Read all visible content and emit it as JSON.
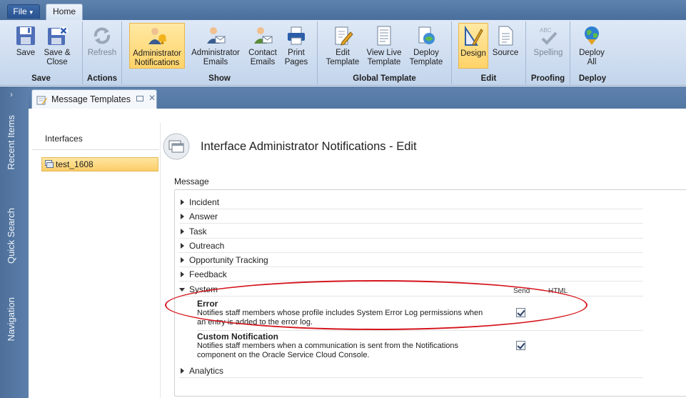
{
  "tabs": {
    "file": "File",
    "home": "Home"
  },
  "ribbon": {
    "groups": [
      {
        "label": "Save",
        "buttons": [
          {
            "label1": "Save",
            "label2": "",
            "icon": "floppy-icon"
          },
          {
            "label1": "Save &",
            "label2": "Close",
            "icon": "save-close-icon"
          }
        ]
      },
      {
        "label": "Actions",
        "buttons": [
          {
            "label1": "Refresh",
            "label2": "",
            "icon": "refresh-icon"
          }
        ]
      },
      {
        "label": "Show",
        "buttons": [
          {
            "label1": "Administrator",
            "label2": "Notifications",
            "icon": "admin-bell-icon"
          },
          {
            "label1": "Administrator",
            "label2": "Emails",
            "icon": "admin-email-icon"
          },
          {
            "label1": "Contact",
            "label2": "Emails",
            "icon": "contact-email-icon"
          },
          {
            "label1": "Print",
            "label2": "Pages",
            "icon": "printer-icon"
          }
        ]
      },
      {
        "label": "Global Template",
        "buttons": [
          {
            "label1": "Edit",
            "label2": "Template",
            "icon": "edit-template-icon"
          },
          {
            "label1": "View Live",
            "label2": "Template",
            "icon": "view-template-icon"
          },
          {
            "label1": "Deploy",
            "label2": "Template",
            "icon": "deploy-template-icon"
          }
        ]
      },
      {
        "label": "Edit",
        "buttons": [
          {
            "label1": "Design",
            "label2": "",
            "icon": "design-icon"
          },
          {
            "label1": "Source",
            "label2": "",
            "icon": "source-icon"
          }
        ]
      },
      {
        "label": "Proofing",
        "buttons": [
          {
            "label1": "Spelling",
            "label2": "",
            "icon": "spelling-icon"
          }
        ]
      },
      {
        "label": "Deploy",
        "buttons": [
          {
            "label1": "Deploy",
            "label2": "All",
            "icon": "globe-deploy-icon"
          }
        ]
      }
    ]
  },
  "leftnav": {
    "items": [
      "Recent Items",
      "Quick Search",
      "Navigation"
    ]
  },
  "doc_tab": {
    "title": "Message Templates"
  },
  "sidebar": {
    "heading": "Interfaces",
    "items": [
      {
        "label": "test_1608"
      }
    ]
  },
  "main": {
    "title": "Interface Administrator Notifications - Edit",
    "section": "Message",
    "columns": {
      "send": "Send",
      "html": "HTML"
    },
    "categories": [
      "Incident",
      "Answer",
      "Task",
      "Outreach",
      "Opportunity Tracking",
      "Feedback",
      "System",
      "Analytics"
    ],
    "notifications": [
      {
        "title": "Error",
        "desc1": "Notifies staff members whose profile includes System Error Log permissions when",
        "desc2": "an entry is added to the error log.",
        "send": true
      },
      {
        "title": "Custom Notification",
        "desc1": "Notifies staff members when a communication is sent from the Notifications",
        "desc2": "component on the Oracle Service Cloud Console.",
        "send": true
      }
    ]
  },
  "colors": {
    "accent": "#ffd36a",
    "highlight": "#d4141c",
    "nav": "#4d6f99"
  }
}
